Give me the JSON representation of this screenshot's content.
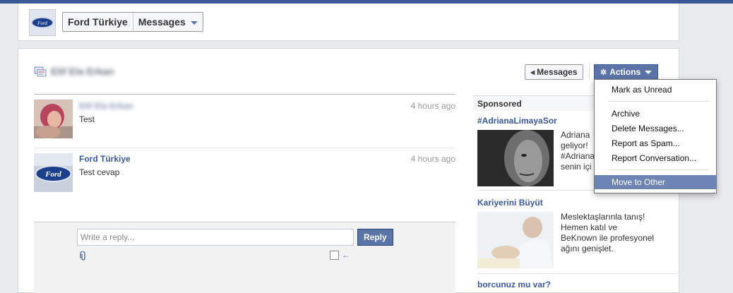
{
  "header": {
    "page_name": "Ford Türkiye",
    "section_label": "Messages"
  },
  "conversation": {
    "participant_name": "Elif Ela Erkan",
    "back_button": "Messages",
    "actions_button": "Actions"
  },
  "messages": [
    {
      "author": "Elif Ela Erkan",
      "time": "4 hours ago",
      "text": "Test"
    },
    {
      "author": "Ford Türkiye",
      "time": "4 hours ago",
      "text": "Test cevap"
    }
  ],
  "reply": {
    "placeholder": "Write a reply...",
    "button": "Reply"
  },
  "sidebar": {
    "heading": "Sponsored",
    "ads": [
      {
        "title": "#AdrianaLimayaSor",
        "body": "Adriana\ngeliyor!\n#Adriana\nsenin içi"
      },
      {
        "title": "Kariyerini Büyüt",
        "body": "Meslektaşlarınla tanış!\nHemen katıl ve\nBeKnown ile profesyonel\nağını genişlet."
      },
      {
        "title": "borcunuz mu var?",
        "body": ""
      }
    ]
  },
  "actions_menu": {
    "items": [
      "Mark as Unread",
      "Archive",
      "Delete Messages...",
      "Report as Spam...",
      "Report Conversation...",
      "Move to Other"
    ],
    "highlighted": "Move to Other"
  },
  "colors": {
    "brand": "#3b5998",
    "button_blue": "#5b74a8",
    "menu_highlight": "#6d84b4",
    "page_background": "#e9eaed"
  }
}
